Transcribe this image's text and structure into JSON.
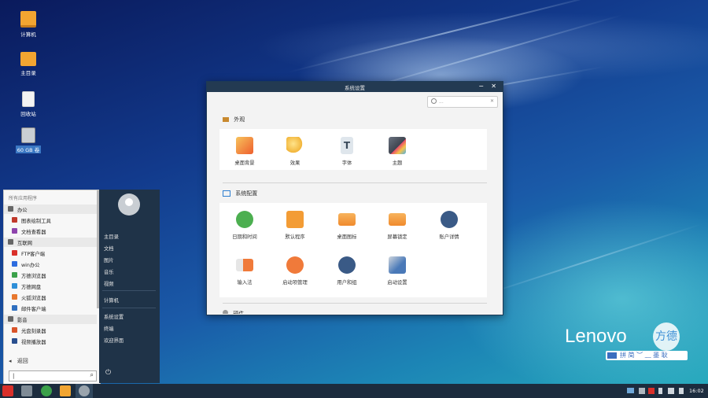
{
  "desktop": {
    "icons": [
      {
        "label": "计算机",
        "icon": "computer-icon"
      },
      {
        "label": "主目录",
        "icon": "home-folder-icon"
      },
      {
        "label": "回收站",
        "icon": "trash-icon"
      },
      {
        "label": "60 GB 卷",
        "icon": "drive-icon"
      }
    ],
    "brand": {
      "logo": "Lenovo",
      "sub": "方德",
      "tagline": "拼 简 ︶ ﹏ 墨 耿"
    }
  },
  "window": {
    "title": "系统设置",
    "minimize": "−",
    "close": "✕",
    "search_placeholder": "...",
    "search_clear": "✕",
    "sections": [
      {
        "title": "外观",
        "items": [
          {
            "label": "桌面背景",
            "icon": "wallpaper-icon",
            "color": "#f07a3a"
          },
          {
            "label": "效果",
            "icon": "effects-wand-icon",
            "color": "#f2b53a"
          },
          {
            "label": "字体",
            "icon": "font-icon",
            "color": "#c8d4dc"
          },
          {
            "label": "主题",
            "icon": "theme-icon",
            "color": "#555c66"
          }
        ]
      },
      {
        "title": "系统配置",
        "items": [
          {
            "label": "日期和时间",
            "icon": "clock-icon",
            "color": "#4caf50"
          },
          {
            "label": "默认程序",
            "icon": "default-apps-icon",
            "color": "#f39c35"
          },
          {
            "label": "桌面图标",
            "icon": "desktop-icons-icon",
            "color": "#f59b3c"
          },
          {
            "label": "屏幕锁定",
            "icon": "screen-lock-icon",
            "color": "#f59b3c"
          },
          {
            "label": "账户详情",
            "icon": "account-icon",
            "color": "#3a5a86"
          },
          {
            "label": "输入法",
            "icon": "input-method-icon",
            "color": "#f07a3a"
          },
          {
            "label": "启动项管理",
            "icon": "startup-manager-icon",
            "color": "#f07a3a"
          },
          {
            "label": "用户和组",
            "icon": "users-groups-icon",
            "color": "#3a5a86"
          },
          {
            "label": "启动设置",
            "icon": "boot-settings-icon",
            "color": "#4a79b8"
          }
        ]
      },
      {
        "title": "硬件",
        "items": []
      }
    ]
  },
  "startmenu": {
    "header": "所有应用程序",
    "rows": [
      {
        "type": "cat",
        "label": "办公",
        "icon": "office-icon",
        "color": "#666"
      },
      {
        "type": "app",
        "label": "图表绘制工具",
        "icon": "diagram-tool-icon",
        "color": "#c0392b"
      },
      {
        "type": "app",
        "label": "文档查看器",
        "icon": "document-viewer-icon",
        "color": "#8e44ad"
      },
      {
        "type": "cat",
        "label": "互联网",
        "icon": "internet-icon",
        "color": "#666"
      },
      {
        "type": "app",
        "label": "FTP客户端",
        "icon": "ftp-icon",
        "color": "#d9302a"
      },
      {
        "type": "app",
        "label": "win办公",
        "icon": "bluetooth-icon",
        "color": "#2d6cdf"
      },
      {
        "type": "app",
        "label": "方德浏览器",
        "icon": "browser-icon",
        "color": "#3ba14a"
      },
      {
        "type": "app",
        "label": "方德网盘",
        "icon": "cloud-disk-icon",
        "color": "#2f8fd8"
      },
      {
        "type": "app",
        "label": "火狐浏览器",
        "icon": "firefox-icon",
        "color": "#e8772e"
      },
      {
        "type": "app",
        "label": "邮件客户端",
        "icon": "mail-client-icon",
        "color": "#2f6fbf"
      },
      {
        "type": "cat",
        "label": "影音",
        "icon": "media-icon",
        "color": "#666"
      },
      {
        "type": "app",
        "label": "光盘刻录器",
        "icon": "disc-burner-icon",
        "color": "#d9542a"
      },
      {
        "type": "app",
        "label": "视频播放器",
        "icon": "video-player-icon",
        "color": "#2a4f8f"
      }
    ],
    "back_label": "返回",
    "back_arrow": "◂",
    "search_value": "|",
    "search_icon": "⌕",
    "right_items": [
      "主目录",
      "文档",
      "图片",
      "音乐",
      "视频",
      "计算机",
      "系统设置",
      "终端",
      "欢迎界面"
    ],
    "power_glyph": "⏻"
  },
  "taskbar": {
    "apps": [
      {
        "name": "start-button",
        "color": "#d9302a"
      },
      {
        "name": "show-desktop-icon",
        "color": "#7f8b96"
      },
      {
        "name": "browser-icon",
        "color": "#3ba14a"
      },
      {
        "name": "file-manager-icon",
        "color": "#f2a531"
      },
      {
        "name": "settings-icon",
        "color": "#9aa4ad"
      }
    ],
    "clock": "16:02"
  }
}
